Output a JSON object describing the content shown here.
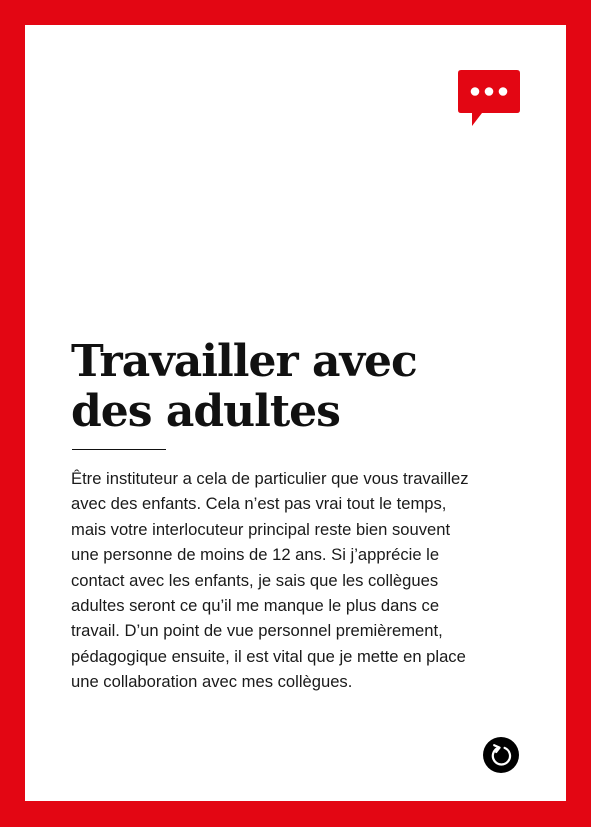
{
  "card": {
    "border_color": "#e30613",
    "icons": {
      "top": "speech-bubble-ellipsis-icon",
      "bottom": "turn-card-arrow-icon"
    }
  },
  "title": {
    "lines": [
      "Travailler avec",
      "des adultes"
    ]
  },
  "body": {
    "lines": [
      "Être instituteur a cela de particulier que vous travaillez",
      "avec des enfants. Cela n’est pas vrai tout le temps,",
      "mais votre interlocuteur principal reste bien souvent",
      "une personne de moins de 12 ans. Si j’apprécie le",
      "contact avec les enfants, je sais que les collègues",
      "adultes seront ce qu’il me manque le plus dans ce",
      "travail. D’un point de vue personnel premièrement,",
      "pédagogique ensuite, il est vital que je mette en place",
      "une collaboration avec mes collègues."
    ]
  }
}
